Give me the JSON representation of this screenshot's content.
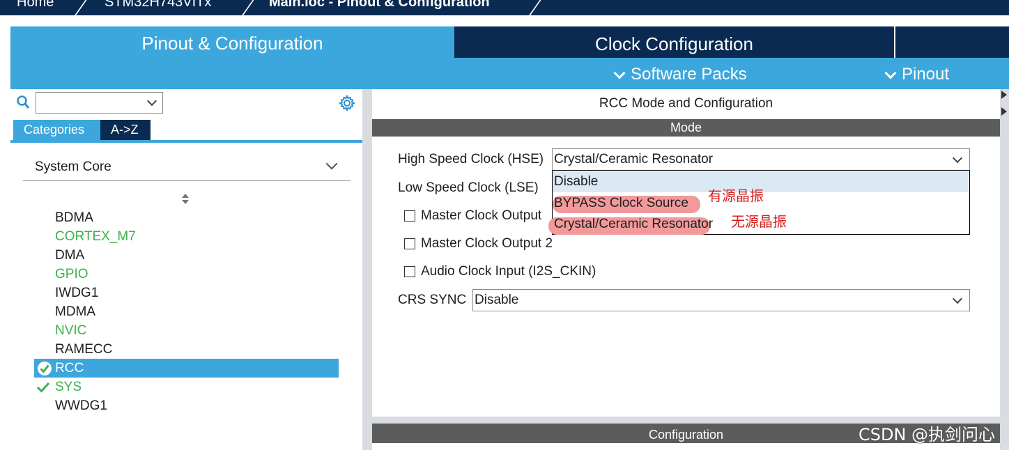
{
  "breadcrumb": [
    "Home",
    "STM32H743VITx",
    "Main.ioc - Pinout & Configuration"
  ],
  "tabs": {
    "pinout": "Pinout & Configuration",
    "clock": "Clock Configuration"
  },
  "submenu": {
    "software_packs": "Software Packs",
    "pinout": "Pinout"
  },
  "left": {
    "search_value": "",
    "cat_tabs": [
      "Categories",
      "A->Z"
    ],
    "group": "System Core",
    "items": [
      {
        "label": "BDMA",
        "color": "#1e1e1e"
      },
      {
        "label": "CORTEX_M7",
        "color": "#3cb04a"
      },
      {
        "label": "DMA",
        "color": "#1e1e1e"
      },
      {
        "label": "GPIO",
        "color": "#3cb04a"
      },
      {
        "label": "IWDG1",
        "color": "#1e1e1e"
      },
      {
        "label": "MDMA",
        "color": "#1e1e1e"
      },
      {
        "label": "NVIC",
        "color": "#3cb04a"
      },
      {
        "label": "RAMECC",
        "color": "#1e1e1e"
      },
      {
        "label": "RCC",
        "selected": true,
        "checked": true
      },
      {
        "label": "SYS",
        "color": "#3cb04a",
        "checked": true
      },
      {
        "label": "WWDG1",
        "color": "#1e1e1e"
      }
    ]
  },
  "right": {
    "title": "RCC Mode and Configuration",
    "mode_header": "Mode",
    "hse_label": "High Speed Clock (HSE)",
    "hse_value": "Crystal/Ceramic Resonator",
    "lse_label": "Low Speed Clock (LSE)",
    "options": [
      "Disable",
      "BYPASS Clock Source",
      "Crystal/Ceramic Resonator"
    ],
    "annotations": {
      "bypass": "有源晶振",
      "crystal": "无源晶振"
    },
    "checkboxes": [
      "Master Clock Output",
      "Master Clock Output 2",
      "Audio Clock Input (I2S_CKIN)"
    ],
    "crs_label": "CRS SYNC",
    "crs_value": "Disable",
    "config_header": "Configuration"
  },
  "watermark": "CSDN @执剑问心",
  "colors": {
    "accent": "#3ca7dc",
    "navy": "#0b2a52",
    "enabled_green": "#3cb04a",
    "annotation_red": "#d6201c"
  }
}
